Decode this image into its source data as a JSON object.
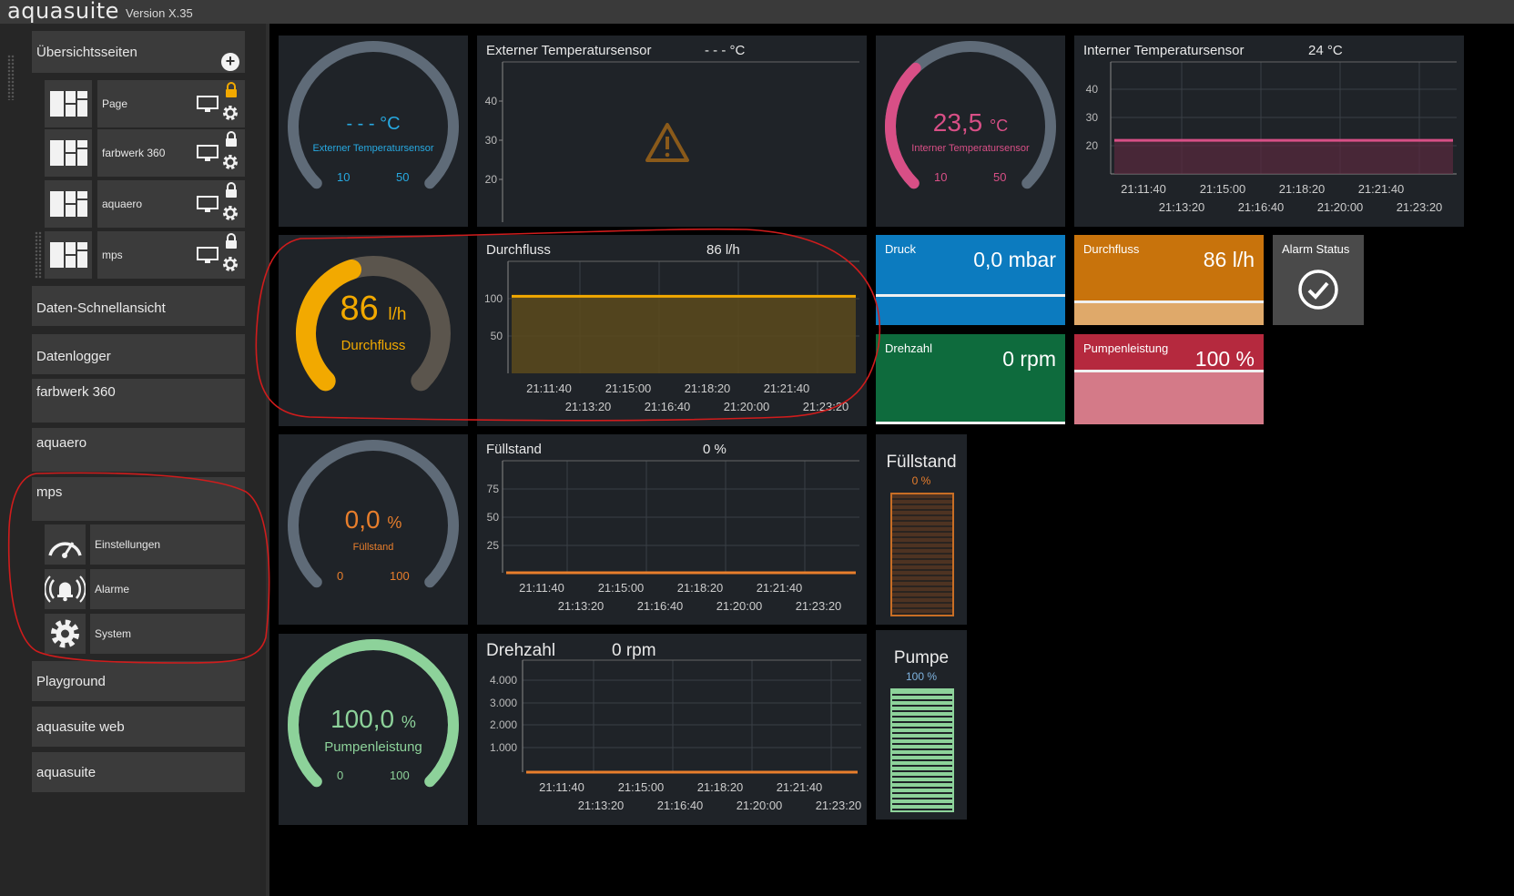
{
  "app": {
    "name": "aquasuite",
    "version": "Version X.35"
  },
  "colors": {
    "flow_orange": "#f2a900",
    "temp_pink": "#d84f86",
    "level_orange": "#e87e2c",
    "pump_green": "#8dd29a",
    "ext_blue": "#27a9e1",
    "tile_blue": "#0c7bbf",
    "tile_orange": "#c8730c",
    "tile_green": "#0e6b3d",
    "tile_red": "#b5293e"
  },
  "sidebar": {
    "overview_label": "Übersichtsseiten",
    "pages": [
      {
        "name": "Page",
        "lock": "orange",
        "icon": "layout-icon"
      },
      {
        "name": "farbwerk 360",
        "lock": "white",
        "icon": "layout-icon"
      },
      {
        "name": "aquaero",
        "lock": "white",
        "icon": "layout-icon"
      },
      {
        "name": "mps",
        "lock": "white",
        "icon": "layout-icon"
      }
    ],
    "items": [
      "Daten-Schnellansicht",
      "Datenlogger",
      "farbwerk 360",
      "aquaero",
      "mps"
    ],
    "mps_sub": [
      {
        "name": "Einstellungen",
        "icon": "gauge-icon"
      },
      {
        "name": "Alarme",
        "icon": "alarm-bell-icon"
      },
      {
        "name": "System",
        "icon": "gear-icon"
      }
    ],
    "bottom_items": [
      "Playground",
      "aquasuite web",
      "aquasuite"
    ]
  },
  "gauges": {
    "ext_temp": {
      "value": "- - -",
      "unit": "°C",
      "label": "Externer Temperatursensor",
      "min": "10",
      "max": "50",
      "level": null
    },
    "int_temp": {
      "value": "23,5",
      "unit": "°C",
      "label": "Interner Temperatursensor",
      "min": "10",
      "max": "50",
      "level": 0.34
    },
    "flow": {
      "value": "86",
      "unit": "l/h",
      "label": "Durchfluss",
      "level": 0.43
    },
    "fill": {
      "value": "0,0",
      "unit": "%",
      "label": "Füllstand",
      "min": "0",
      "max": "100",
      "level": 0
    },
    "pump": {
      "value": "100,0",
      "unit": "%",
      "label": "Pumpenleistung",
      "min": "0",
      "max": "100",
      "level": 1.0
    }
  },
  "charts": {
    "ext_temp": {
      "title": "Externer Temperatursensor",
      "value": "- - - °C",
      "yticks": [
        "40",
        "30",
        "20"
      ],
      "warning_icon": "warning-triangle-icon"
    },
    "int_temp": {
      "title": "Interner Temperatursensor",
      "value": "24 °C",
      "yticks": [
        "40",
        "30",
        "20"
      ],
      "xticks_top": [
        "21:11:40",
        "21:15:00",
        "21:18:20",
        "21:21:40"
      ],
      "xticks_bottom": [
        "21:13:20",
        "21:16:40",
        "21:20:00",
        "21:23:20"
      ]
    },
    "flow": {
      "title": "Durchfluss",
      "value": "86 l/h",
      "yticks": [
        "100",
        "50"
      ],
      "xticks_top": [
        "21:11:40",
        "21:15:00",
        "21:18:20",
        "21:21:40"
      ],
      "xticks_bottom": [
        "21:13:20",
        "21:16:40",
        "21:20:00",
        "21:23:20"
      ]
    },
    "fill": {
      "title": "Füllstand",
      "value": "0 %",
      "yticks": [
        "75",
        "50",
        "25"
      ],
      "xticks_top": [
        "21:11:40",
        "21:15:00",
        "21:18:20",
        "21:21:40"
      ],
      "xticks_bottom": [
        "21:13:20",
        "21:16:40",
        "21:20:00",
        "21:23:20"
      ]
    },
    "rpm": {
      "title": "Drehzahl",
      "value": "0 rpm",
      "yticks": [
        "4.000",
        "3.000",
        "2.000",
        "1.000"
      ],
      "xticks_top": [
        "21:11:40",
        "21:15:00",
        "21:18:20",
        "21:21:40"
      ],
      "xticks_bottom": [
        "21:13:20",
        "21:16:40",
        "21:20:00",
        "21:23:20"
      ]
    }
  },
  "chart_data": [
    {
      "type": "line",
      "title": "Interner Temperatursensor",
      "ylim": [
        15,
        45
      ],
      "x": [
        "21:10:00",
        "21:25:00"
      ],
      "series": [
        {
          "values": [
            24,
            24
          ]
        }
      ]
    },
    {
      "type": "area",
      "title": "Durchfluss",
      "ylim": [
        0,
        125
      ],
      "x": [
        "21:10:00",
        "21:25:00"
      ],
      "series": [
        {
          "values": [
            86,
            86
          ]
        }
      ]
    },
    {
      "type": "line",
      "title": "Füllstand",
      "ylim": [
        0,
        100
      ],
      "x": [
        "21:10:00",
        "21:25:00"
      ],
      "series": [
        {
          "values": [
            0,
            0
          ]
        }
      ]
    },
    {
      "type": "line",
      "title": "Drehzahl",
      "ylim": [
        0,
        4500
      ],
      "x": [
        "21:10:00",
        "21:25:00"
      ],
      "series": [
        {
          "values": [
            0,
            0
          ]
        }
      ]
    }
  ],
  "stats": {
    "druck": {
      "label": "Druck",
      "value": "0,0 mbar"
    },
    "durchfluss": {
      "label": "Durchfluss",
      "value": "86 l/h"
    },
    "alarm": {
      "label": "Alarm Status",
      "icon": "check-circle-icon"
    },
    "drehzahl": {
      "label": "Drehzahl",
      "value": "0 rpm"
    },
    "pumpenleistung": {
      "label": "Pumpenleistung",
      "value": "100 %"
    }
  },
  "levels": {
    "fill": {
      "title": "Füllstand",
      "value": "0 %",
      "level": 0
    },
    "pump": {
      "title": "Pumpe",
      "value": "100 %",
      "level": 1.0
    }
  }
}
